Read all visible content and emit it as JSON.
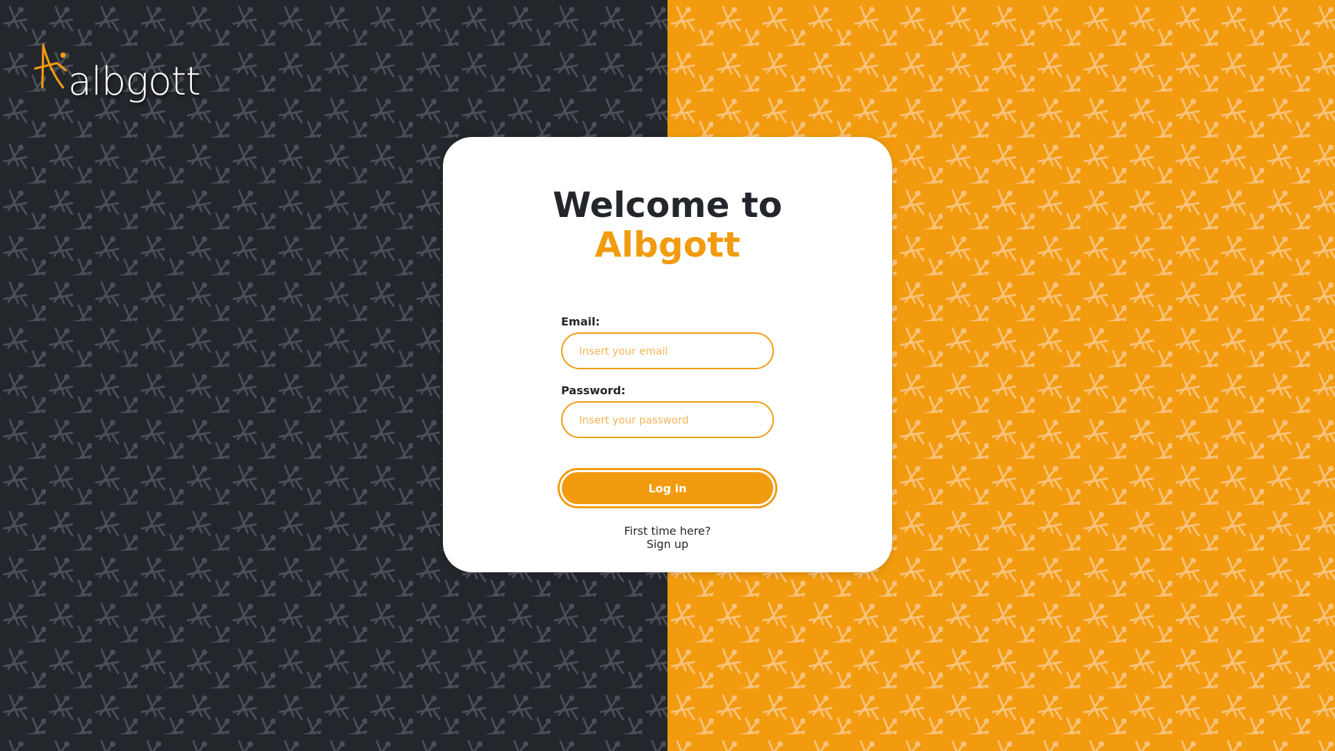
{
  "brand": {
    "name": "albgott",
    "logo_icon": "albgott-figure-logo"
  },
  "colors": {
    "dark": "#23262b",
    "accent": "#f29b0f",
    "white": "#ffffff"
  },
  "card": {
    "title_line_1": "Welcome to",
    "title_line_2": "Albgott"
  },
  "form": {
    "email_label": "Email:",
    "email_placeholder": "Insert your email",
    "email_value": "",
    "password_label": "Password:",
    "password_placeholder": "Insert your password",
    "password_value": "",
    "login_label": "Log in"
  },
  "signup": {
    "prompt": "First time here?",
    "link_label": "Sign up"
  }
}
